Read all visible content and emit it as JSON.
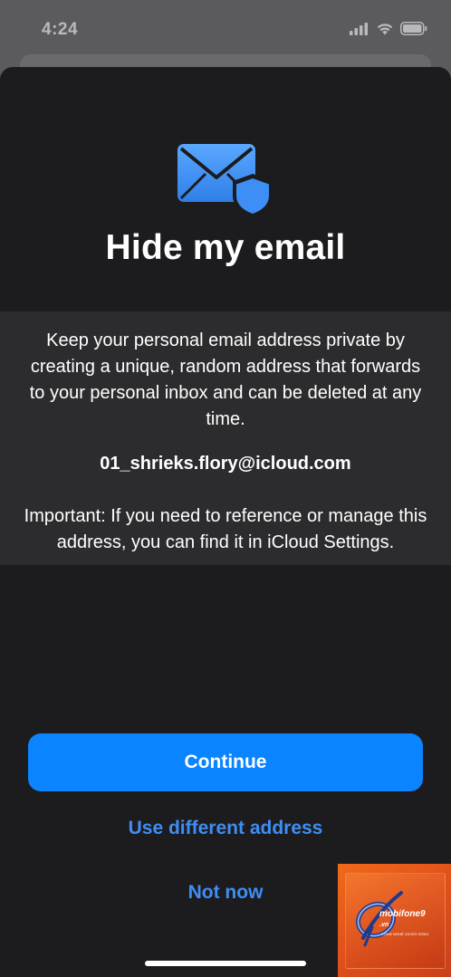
{
  "status_bar": {
    "time": "4:24",
    "icons": [
      "cellular-signal-icon",
      "wifi-icon",
      "battery-icon"
    ]
  },
  "sheet": {
    "icon": "envelope-shield-icon",
    "title": "Hide my email",
    "description": "Keep your personal email address private by creating a unique, random address that forwards to your personal inbox and can be deleted at any time.",
    "email_address": "01_shrieks.flory@icloud.com",
    "important_note": "Important: If you need to reference or manage this address, you can find it in iCloud Settings.",
    "continue_label": "Continue",
    "use_different_label": "Use different address",
    "not_now_label": "Not now"
  },
  "watermark": {
    "brand": "mobifone9",
    "tld": ".vn",
    "tagline": "CÔNG NGHỆ VÀ ĐỜI SỐNG"
  },
  "colors": {
    "accent": "#0a84ff",
    "link": "#3d8ef5",
    "sheet_background": "#1c1c1e",
    "info_band": "#2c2c2e",
    "watermark_orange": "#e2521a"
  }
}
